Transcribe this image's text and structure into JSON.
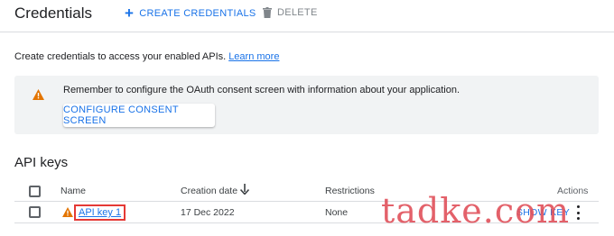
{
  "header": {
    "title": "Credentials",
    "create_label": "CREATE CREDENTIALS",
    "delete_label": "DELETE"
  },
  "intro": {
    "text": "Create credentials to access your enabled APIs.",
    "link": "Learn more"
  },
  "banner": {
    "message": "Remember to configure the OAuth consent screen with information about your application.",
    "button_label": "CONFIGURE CONSENT SCREEN"
  },
  "api_keys": {
    "section_title": "API keys",
    "columns": {
      "name": "Name",
      "creation_date": "Creation date",
      "restrictions": "Restrictions",
      "actions": "Actions"
    },
    "rows": [
      {
        "name": "API key 1",
        "creation_date": "17 Dec 2022",
        "restrictions": "None",
        "action_label": "SHOW KEY"
      }
    ]
  },
  "watermark": "tadke.com",
  "icons": {
    "create": "plus-icon",
    "delete": "trash-icon",
    "banner": "warning-icon",
    "sort": "arrow-down-icon",
    "row_status": "warning-icon",
    "more": "more-vert-icon"
  },
  "colors": {
    "accent": "#1a73e8",
    "warning": "#e37400",
    "highlight_border": "#e53935",
    "watermark": "#e0515a"
  }
}
